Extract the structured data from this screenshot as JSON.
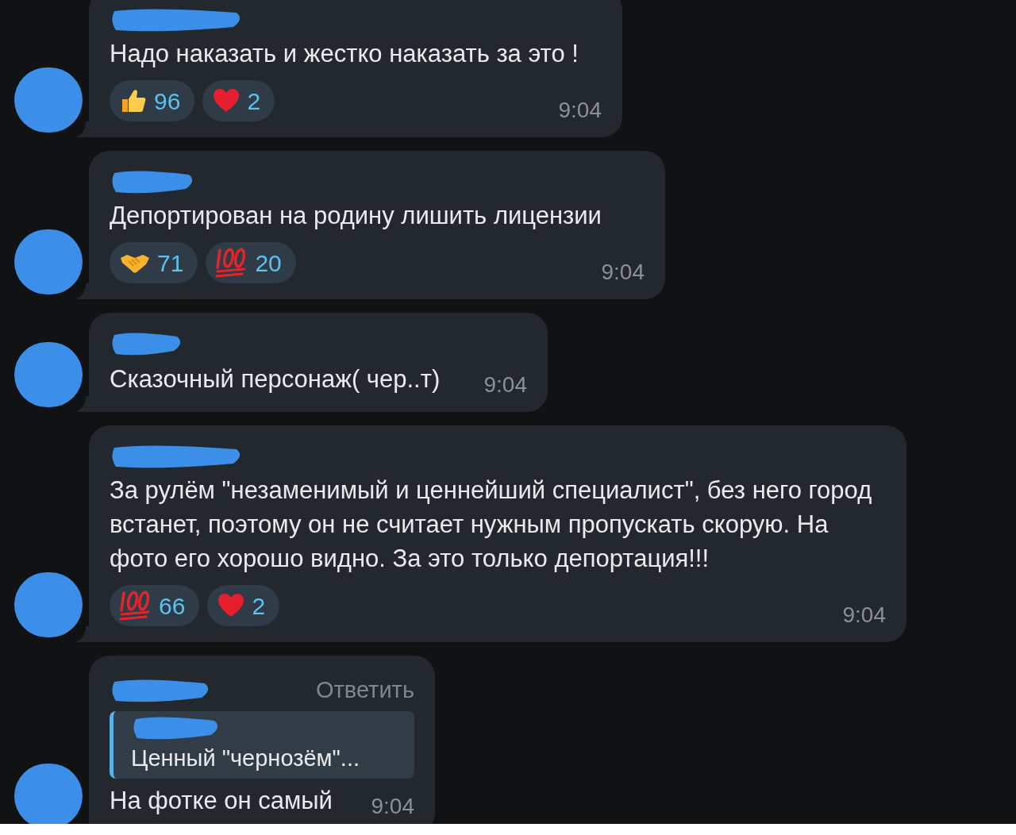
{
  "messages": [
    {
      "text": "Надо наказать и жестко наказать за это !",
      "time": "9:04",
      "reactions": [
        {
          "kind": "thumbs_up",
          "count": "96"
        },
        {
          "kind": "heart",
          "count": "2"
        }
      ]
    },
    {
      "text": "Депортирован на родину лишить лицензии",
      "time": "9:04",
      "reactions": [
        {
          "kind": "handshake",
          "count": "71"
        },
        {
          "kind": "hundred",
          "count": "20"
        }
      ]
    },
    {
      "text": "Сказочный персонаж( чер..т)",
      "time": "9:04"
    },
    {
      "text": "За рулём \"незаменимый и ценнейший специалист\", без него город встанет, поэтому он не считает нужным пропускать скорую. На фото его хорошо видно. За это только депортация!!!",
      "time": "9:04",
      "reactions": [
        {
          "kind": "hundred",
          "count": "66"
        },
        {
          "kind": "heart",
          "count": "2"
        }
      ]
    },
    {
      "text": "На фотке он самый",
      "time": "9:04",
      "reply_action": "Ответить",
      "quote": {
        "text": "Ценный \"чернозём\"..."
      }
    }
  ]
}
